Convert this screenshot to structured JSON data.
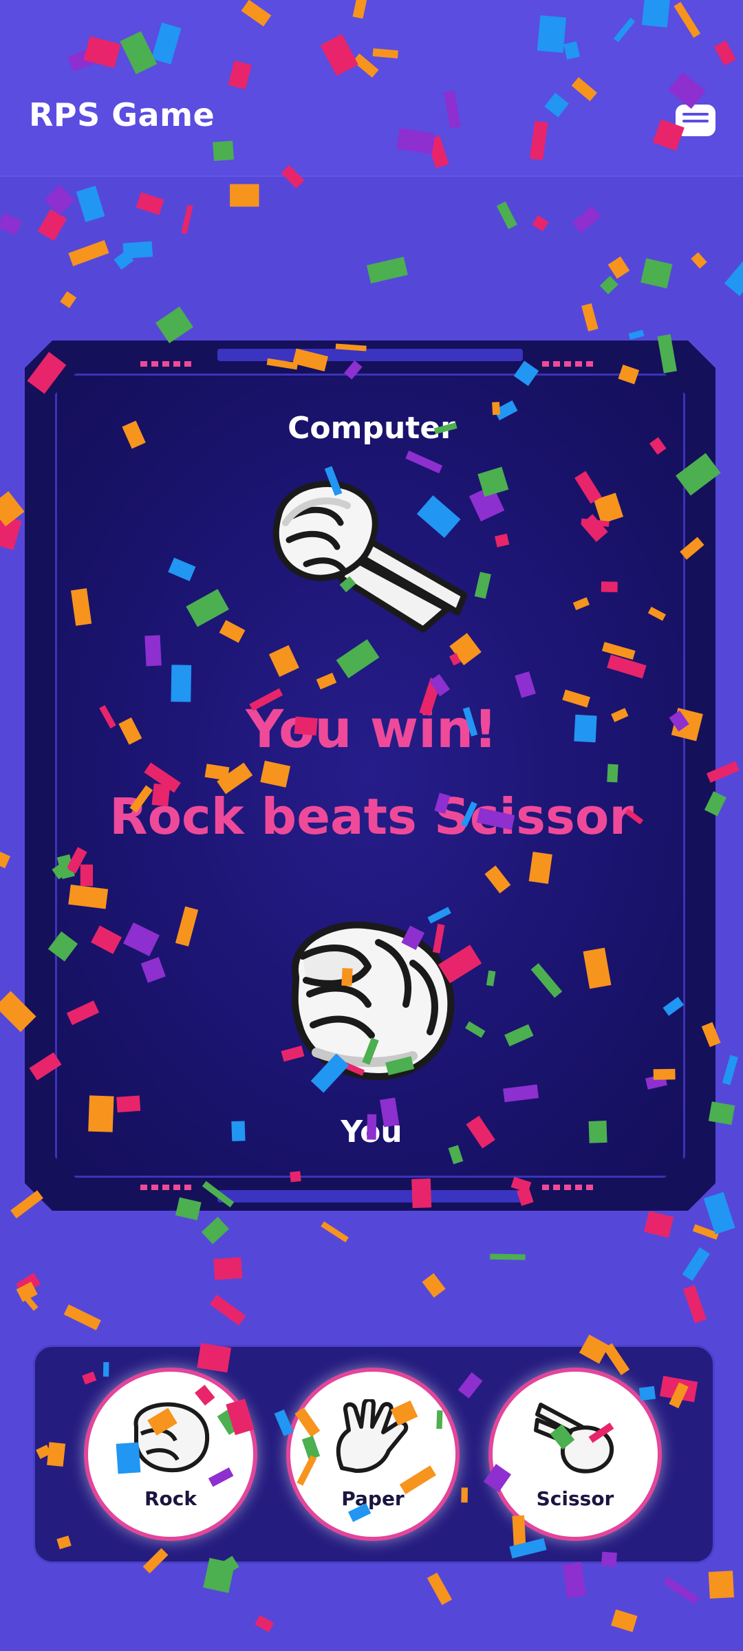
{
  "header": {
    "title": "RPS Game"
  },
  "arena": {
    "computer_label": "Computer",
    "player_label": "You",
    "result_title": "You win!",
    "result_detail": "Rock beats Scissor",
    "computer_choice": "scissors",
    "player_choice": "rock"
  },
  "choices": [
    {
      "label": "Rock",
      "icon": "rock-hand-icon"
    },
    {
      "label": "Paper",
      "icon": "paper-hand-icon"
    },
    {
      "label": "Scissor",
      "icon": "scissors-hand-icon"
    }
  ],
  "colors": {
    "background": "#5548d9",
    "arena": "#1b1470",
    "accent_pink": "#ef4a9a"
  }
}
